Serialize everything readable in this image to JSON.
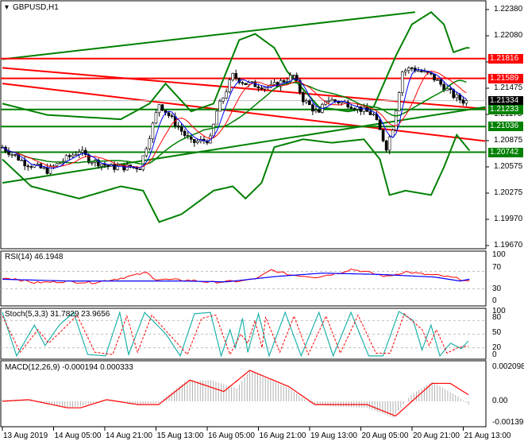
{
  "header": {
    "title": "GBPUSD,H1"
  },
  "price_axis": [
    "1.22380",
    "1.22080",
    "1.21780",
    "1.21475",
    "1.21175",
    "1.20875",
    "1.20575",
    "1.20275",
    "1.19970",
    "1.19670"
  ],
  "price_tags": [
    {
      "text": "1.21816",
      "color": "#ff0000"
    },
    {
      "text": "1.21589",
      "color": "#ff0000"
    },
    {
      "text": "1.21334",
      "color": "#000000"
    },
    {
      "text": "1.21233",
      "color": "#008000"
    },
    {
      "text": "1.21036",
      "color": "#008000"
    },
    {
      "text": "1.20742",
      "color": "#008000"
    }
  ],
  "rsi": {
    "title": "RSI(14) 46.1948",
    "axis": [
      "100",
      "70",
      "30",
      "0"
    ]
  },
  "stoch": {
    "title": "Stoch(5,3,3) 31.7829 23.9656",
    "axis": [
      "100",
      "80",
      "50",
      "20",
      "0"
    ]
  },
  "macd": {
    "title": "MACD(12,26,9) -0.000194 0.000333",
    "axis": [
      "0.002098",
      "0.00",
      "-0.00139"
    ]
  },
  "time_axis": [
    "13 Aug 2019",
    "14 Aug 05:00",
    "14 Aug 21:00",
    "15 Aug 13:00",
    "16 Aug 05:00",
    "16 Aug 21:00",
    "19 Aug 13:00",
    "20 Aug 05:00",
    "20 Aug 21:00",
    "21 Aug 13:00"
  ],
  "chart_data": {
    "type": "candlestick",
    "symbol": "GBPUSD",
    "timeframe": "H1",
    "ylim": [
      1.1967,
      1.2238
    ],
    "bars": 146,
    "close_keypoints": [
      [
        0,
        1.208
      ],
      [
        7,
        1.2062
      ],
      [
        14,
        1.2053
      ],
      [
        24,
        1.2076
      ],
      [
        27,
        1.2066
      ],
      [
        34,
        1.2057
      ],
      [
        43,
        1.2057
      ],
      [
        49,
        1.213
      ],
      [
        53,
        1.2112
      ],
      [
        59,
        1.2085
      ],
      [
        65,
        1.2089
      ],
      [
        67,
        1.2121
      ],
      [
        72,
        1.2162
      ],
      [
        76,
        1.2153
      ],
      [
        84,
        1.2149
      ],
      [
        91,
        1.2162
      ],
      [
        94,
        1.2135
      ],
      [
        99,
        1.2117
      ],
      [
        101,
        1.2135
      ],
      [
        108,
        1.213
      ],
      [
        116,
        1.2117
      ],
      [
        120,
        1.208
      ],
      [
        122,
        1.2103
      ],
      [
        125,
        1.2167
      ],
      [
        128,
        1.2171
      ],
      [
        134,
        1.2162
      ],
      [
        141,
        1.2139
      ],
      [
        144,
        1.2133
      ]
    ],
    "bb_upper": [
      [
        0,
        1.213
      ],
      [
        14,
        1.2117
      ],
      [
        37,
        1.2112
      ],
      [
        46,
        1.213
      ],
      [
        51,
        1.2153
      ],
      [
        59,
        1.2121
      ],
      [
        66,
        1.213
      ],
      [
        74,
        1.2203
      ],
      [
        79,
        1.221
      ],
      [
        85,
        1.2194
      ],
      [
        89,
        1.2167
      ],
      [
        99,
        1.2126
      ],
      [
        108,
        1.2121
      ],
      [
        116,
        1.2126
      ],
      [
        123,
        1.2185
      ],
      [
        128,
        1.2221
      ],
      [
        134,
        1.2235
      ],
      [
        138,
        1.2221
      ],
      [
        141,
        1.2189
      ],
      [
        145,
        1.2194
      ]
    ],
    "bb_lower": [
      [
        0,
        1.2066
      ],
      [
        9,
        1.2035
      ],
      [
        24,
        1.2021
      ],
      [
        37,
        1.2035
      ],
      [
        44,
        1.203
      ],
      [
        49,
        1.1994
      ],
      [
        56,
        1.2003
      ],
      [
        66,
        1.203
      ],
      [
        72,
        1.2035
      ],
      [
        76,
        1.2021
      ],
      [
        81,
        1.2039
      ],
      [
        85,
        1.208
      ],
      [
        94,
        1.2089
      ],
      [
        103,
        1.2085
      ],
      [
        113,
        1.2089
      ],
      [
        118,
        1.2066
      ],
      [
        121,
        1.2025
      ],
      [
        126,
        1.203
      ],
      [
        134,
        1.2025
      ],
      [
        138,
        1.2057
      ],
      [
        142,
        1.2094
      ],
      [
        146,
        1.2076
      ]
    ],
    "horizontal_levels": [
      1.21816,
      1.21589,
      1.21233,
      1.21036,
      1.20742
    ],
    "bid": 1.21334,
    "trendlines": [
      {
        "color": "#ff0000",
        "from": [
          0,
          1.2171
        ],
        "to": [
          151,
          1.2124
        ]
      },
      {
        "color": "#ff0000",
        "from": [
          0,
          1.2153
        ],
        "to": [
          151,
          1.2087
        ]
      },
      {
        "color": "#008000",
        "from": [
          0,
          1.2181
        ],
        "to": [
          129,
          1.2235
        ]
      },
      {
        "color": "#008000",
        "from": [
          0,
          1.2039
        ],
        "to": [
          151,
          1.2126
        ]
      }
    ],
    "rsi_keypoints": [
      [
        0,
        55
      ],
      [
        4,
        53
      ],
      [
        10,
        44
      ],
      [
        20,
        47
      ],
      [
        28,
        44
      ],
      [
        36,
        53
      ],
      [
        45,
        67
      ],
      [
        48,
        52
      ],
      [
        60,
        49
      ],
      [
        65,
        45
      ],
      [
        75,
        48
      ],
      [
        80,
        55
      ],
      [
        84,
        73
      ],
      [
        90,
        62
      ],
      [
        98,
        57
      ],
      [
        105,
        66
      ],
      [
        109,
        75
      ],
      [
        113,
        70
      ],
      [
        120,
        58
      ],
      [
        126,
        69
      ],
      [
        132,
        63
      ],
      [
        136,
        61
      ],
      [
        143,
        53
      ],
      [
        146,
        46
      ]
    ],
    "rsi_signal": [
      [
        0,
        52
      ],
      [
        20,
        48
      ],
      [
        40,
        48
      ],
      [
        55,
        48
      ],
      [
        70,
        46
      ],
      [
        85,
        58
      ],
      [
        100,
        66
      ],
      [
        118,
        63
      ],
      [
        135,
        57
      ],
      [
        143,
        48
      ],
      [
        146,
        52
      ]
    ],
    "stoch_main": [
      [
        0,
        98
      ],
      [
        8,
        2
      ],
      [
        18,
        70
      ],
      [
        24,
        25
      ],
      [
        32,
        70
      ],
      [
        40,
        98
      ],
      [
        48,
        5
      ],
      [
        58,
        2
      ],
      [
        66,
        98
      ],
      [
        71,
        5
      ],
      [
        80,
        98
      ],
      [
        92,
        50
      ],
      [
        100,
        2
      ],
      [
        108,
        95
      ],
      [
        117,
        98
      ],
      [
        123,
        2
      ],
      [
        128,
        60
      ],
      [
        131,
        20
      ],
      [
        135,
        85
      ],
      [
        138,
        10
      ],
      [
        144,
        95
      ],
      [
        150,
        2
      ],
      [
        159,
        98
      ],
      [
        168,
        2
      ],
      [
        178,
        98
      ],
      [
        186,
        2
      ],
      [
        196,
        98
      ],
      [
        206,
        2
      ],
      [
        214,
        2
      ],
      [
        223,
        100
      ],
      [
        231,
        80
      ],
      [
        236,
        15
      ],
      [
        241,
        70
      ],
      [
        246,
        2
      ],
      [
        252,
        30
      ],
      [
        258,
        18
      ],
      [
        262,
        35
      ]
    ],
    "stoch_signal": [
      [
        0,
        90
      ],
      [
        10,
        10
      ],
      [
        20,
        60
      ],
      [
        26,
        30
      ],
      [
        34,
        60
      ],
      [
        42,
        92
      ],
      [
        52,
        10
      ],
      [
        62,
        5
      ],
      [
        70,
        90
      ],
      [
        76,
        10
      ],
      [
        84,
        92
      ],
      [
        96,
        40
      ],
      [
        104,
        5
      ],
      [
        112,
        85
      ],
      [
        120,
        92
      ],
      [
        128,
        5
      ],
      [
        134,
        50
      ],
      [
        138,
        30
      ],
      [
        142,
        80
      ],
      [
        146,
        20
      ],
      [
        148,
        88
      ],
      [
        156,
        10
      ],
      [
        164,
        90
      ],
      [
        172,
        5
      ],
      [
        182,
        90
      ],
      [
        190,
        8
      ],
      [
        200,
        92
      ],
      [
        210,
        8
      ],
      [
        218,
        8
      ],
      [
        226,
        95
      ],
      [
        236,
        60
      ],
      [
        240,
        25
      ],
      [
        244,
        60
      ],
      [
        250,
        8
      ],
      [
        256,
        20
      ],
      [
        262,
        24
      ]
    ],
    "macd_keypoints": [
      [
        0,
        0
      ],
      [
        10,
        0.0001
      ],
      [
        25,
        -0.0004
      ],
      [
        30,
        -0.0004
      ],
      [
        40,
        0.0001
      ],
      [
        52,
        -0.0002
      ],
      [
        60,
        -0.0002
      ],
      [
        72,
        0.0013
      ],
      [
        85,
        0.0006
      ],
      [
        95,
        0.0019
      ],
      [
        110,
        0.0009
      ],
      [
        120,
        -0.0002
      ],
      [
        140,
        -0.0002
      ],
      [
        151,
        -0.0009
      ],
      [
        165,
        0.0011
      ],
      [
        172,
        0.0011
      ],
      [
        179,
        0.0004
      ]
    ],
    "macd_hist": [
      [
        0,
        0.0001
      ],
      [
        10,
        0.0001
      ],
      [
        25,
        -0.0004
      ],
      [
        30,
        -0.0003
      ],
      [
        40,
        0.0001
      ],
      [
        50,
        -0.0002
      ],
      [
        60,
        -0.0001
      ],
      [
        70,
        0.0012
      ],
      [
        80,
        0.0013
      ],
      [
        90,
        0.0008
      ],
      [
        95,
        0.0019
      ],
      [
        110,
        0.0008
      ],
      [
        118,
        -0.0001
      ],
      [
        125,
        -0.0003
      ],
      [
        140,
        -0.0004
      ],
      [
        150,
        -0.001
      ],
      [
        157,
        0.0004
      ],
      [
        165,
        0.0012
      ],
      [
        175,
        0.0003
      ],
      [
        179,
        -0.0002
      ]
    ]
  }
}
